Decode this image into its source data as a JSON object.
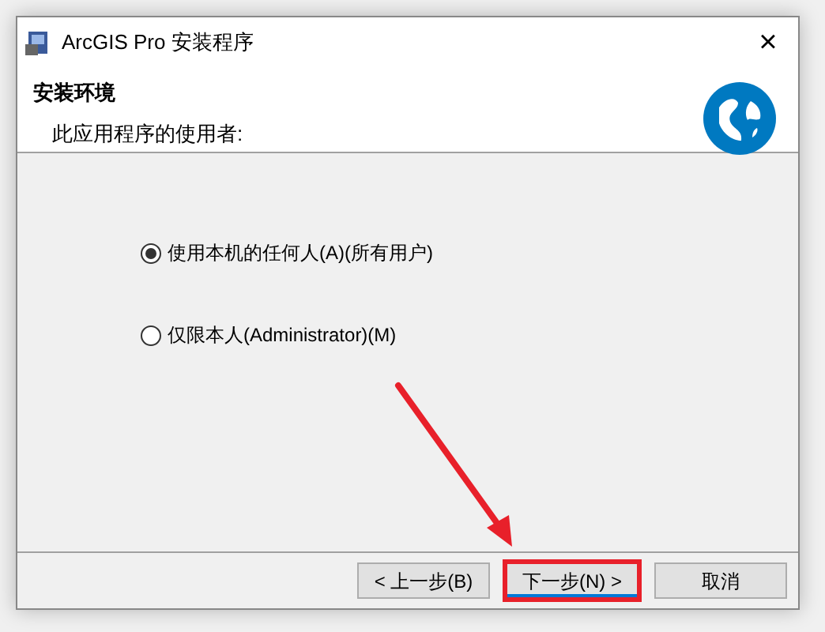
{
  "window": {
    "title": "ArcGIS Pro 安装程序",
    "close": "×"
  },
  "header": {
    "title": "安装环境",
    "subtitle": "此应用程序的使用者:"
  },
  "options": [
    {
      "label": "使用本机的任何人(A)(所有用户)",
      "selected": true
    },
    {
      "label": "仅限本人(Administrator)(M)",
      "selected": false
    }
  ],
  "buttons": [
    {
      "label": "< 上一步(B)",
      "highlighted": false
    },
    {
      "label": "下一步(N) >",
      "highlighted": true
    },
    {
      "label": "取消",
      "highlighted": false
    }
  ]
}
